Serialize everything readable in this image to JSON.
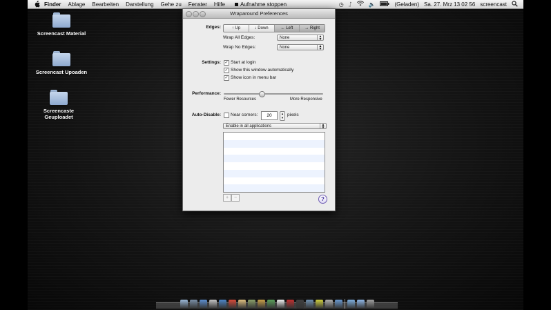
{
  "menubar": {
    "menus": [
      "Finder",
      "Ablage",
      "Bearbeiten",
      "Darstellung",
      "Gehe zu",
      "Fenster",
      "Hilfe"
    ],
    "recording": "Aufnahme stoppen",
    "battery": "(Geladen)",
    "datetime": "Sa. 27. Mrz  13 02 56",
    "user": "screencast"
  },
  "desktop_icons": [
    "Screencast Material",
    "Screencast Upoaden",
    "Screencaste Geuploadet"
  ],
  "window": {
    "title": "Wraparound Preferences",
    "edges": {
      "label": "Edges:",
      "segments": [
        "↑ Up",
        "↓ Down",
        "← Left",
        "→ Right"
      ],
      "wrap_all_label": "Wrap All Edges:",
      "wrap_all_value": "None",
      "wrap_no_label": "Wrap No Edges:",
      "wrap_no_value": "None"
    },
    "settings": {
      "label": "Settings:",
      "options": [
        "Start at login",
        "Show this window automatically",
        "Show icon in menu bar"
      ]
    },
    "performance": {
      "label": "Performance:",
      "min_label": "Fewer Resources",
      "max_label": "More Responsive",
      "level": 0.38
    },
    "auto_disable": {
      "label": "Auto-Disable:",
      "near_corners_label": "Near corners:",
      "corner_value": "20",
      "unit": "pixels",
      "scope": "Enable in all applications"
    },
    "list_buttons": [
      "+",
      "−"
    ],
    "help": "?"
  },
  "colors": {
    "background": "#141414",
    "window": "#ececec",
    "list_stripe": "#edf3fe"
  },
  "dock": {
    "icons": [
      "finder",
      "system-preferences",
      "safari",
      "itunes",
      "mail",
      "calendar",
      "address-book",
      "preview",
      "photo",
      "ichat",
      "textedit",
      "book",
      "terminal",
      "iphoto",
      "star",
      "script-editor",
      "documents",
      "downloads",
      "applications",
      "trash"
    ]
  }
}
